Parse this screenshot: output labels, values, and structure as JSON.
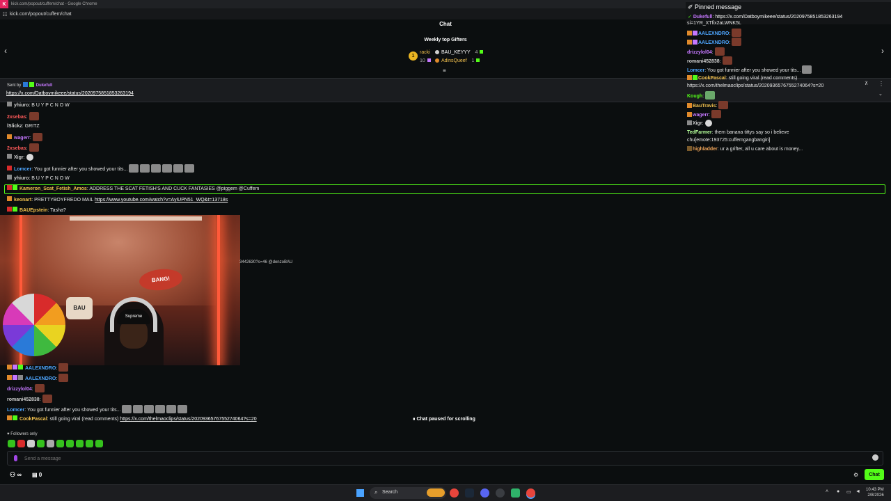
{
  "browser": {
    "window_title": "kick.com/popout/cuffem/chat - Google Chrome",
    "url": "kick.com/popout/cuffem/chat"
  },
  "chat": {
    "title": "Chat",
    "weekly_title": "Weekly top Gifters",
    "gifters": [
      {
        "name": "racki",
        "count": ""
      },
      {
        "name": "BAU_KEYYY",
        "count": "4"
      },
      {
        "name": "",
        "count": "10"
      },
      {
        "name": "AdinsQueef",
        "count": "1"
      }
    ],
    "rank": "1"
  },
  "pinned_left": {
    "sent_by": "Sent by",
    "user": "Dukefull",
    "link": "https://x.com/Datboymikeee/status/2020975851853263194"
  },
  "messages_left": [
    {
      "user": "yhiuro",
      "text": ": B U Y P C N O W",
      "color": "#cfcfcf"
    },
    {
      "user": "2xsebas",
      "text": ":",
      "color": "#ff5a5a"
    },
    {
      "user": "lSlickz",
      "text": ": GRITZ",
      "color": "#cfcfcf"
    },
    {
      "user": "wagerr",
      "text": ":",
      "color": "#c678ff"
    },
    {
      "user": "2xsebas",
      "text": ":",
      "color": "#ff5a5a"
    },
    {
      "user": "Xigr",
      "text": ":",
      "color": "#cfcfcf"
    },
    {
      "user": "Lomcer",
      "text": ": You got funnier after you showed your tits...",
      "color": "#4ea6ff"
    },
    {
      "user": "yhiuro",
      "text": ": B U Y P C N O W",
      "color": "#cfcfcf"
    },
    {
      "user": "Kameron_Scat_Fetish_Amos",
      "text": ": ADDRESS THE SCAT FETISH'S AND CUCK FANTASIES @piggem @Cuffem",
      "color": "#f2c14e"
    },
    {
      "user": "keonart",
      "text": ": PRETTYBOYFREDO MAIL",
      "link": "https://www.youtube.com/watch?v=AyiUPN51_WQ&t=13718s",
      "color": "#f2c14e"
    },
    {
      "user": "BAUEpstein",
      "text": ": Tasha?",
      "color": "#f2c14e"
    },
    {
      "user": "AALEXNDRO",
      "text": ":",
      "color": "#4ea6ff"
    },
    {
      "user": "AALEXNDRO",
      "text": ":",
      "color": "#4ea6ff"
    },
    {
      "user": "drizzylol04",
      "text": ":",
      "color": "#c678ff"
    },
    {
      "user": "romani452838",
      "text": ":",
      "color": "#cfcfcf"
    },
    {
      "user": "Lomcer",
      "text": ": You got funnier after you showed your tits...",
      "color": "#4ea6ff"
    },
    {
      "user": "CookPascal",
      "text": ": still going viral (read comments)",
      "link": "https://x.com/thelmaoclips/status/2020936576755274064?s=20",
      "color": "#f2c14e"
    }
  ],
  "webcam": {
    "sign": "BANG!",
    "pillow": "BAU",
    "cap": "Supreme",
    "peek_text": "3442630?s=46 @denzoBAU"
  },
  "pinned_right": {
    "header": "Pinned message",
    "user": "Dukefull",
    "link": "https://x.com/Datboymikeee/status/2020975851853263194"
  },
  "messages_right": [
    {
      "user": "",
      "text": "si=1YR_XTfix2aLWNK5L",
      "color": "#cfcfcf"
    },
    {
      "user": "AALEXNDRO",
      "text": ":",
      "color": "#4ea6ff"
    },
    {
      "user": "AALEXNDRO",
      "text": ":",
      "color": "#4ea6ff"
    },
    {
      "user": "drizzylol04",
      "text": ":",
      "color": "#c678ff"
    },
    {
      "user": "romani452838",
      "text": ":",
      "color": "#cfcfcf"
    },
    {
      "user": "Lomcer",
      "text": ": You got funnier after you showed your tits...",
      "color": "#4ea6ff"
    },
    {
      "user": "CookPascal",
      "text": ": still going viral (read comments)",
      "color": "#f2c14e"
    },
    {
      "user": "",
      "text": "https://x.com/thelmaoclips/status/2020936576755274064?s=20",
      "color": "#cfcfcf"
    },
    {
      "user": "Kough",
      "text": ":",
      "color": "#53fc18"
    },
    {
      "user": "BauTravis",
      "text": ":",
      "color": "#f2c14e"
    },
    {
      "user": "wagerr",
      "text": ":",
      "color": "#c678ff"
    },
    {
      "user": "Xigr",
      "text": ":",
      "color": "#cfcfcf"
    },
    {
      "user": "TedFarmer",
      "text": ": them banana tittys say so i believe",
      "color": "#b6ff9a"
    },
    {
      "user": "",
      "text": "chu[emote:193725:cuffemgangbangin]",
      "color": "#cfcfcf"
    },
    {
      "user": "highladder",
      "text": ": ur a grifter, all u care about is money...",
      "color": "#f2a65a"
    }
  ],
  "footer": {
    "paused": "Chat paused for scrolling",
    "followers_only": "Followers only",
    "send_placeholder": "Send a message",
    "gift_count": "0",
    "infinity": "∞",
    "chat_button": "Chat"
  },
  "taskbar": {
    "search": "Search",
    "time": "10:43 PM",
    "date": "2/8/2026"
  }
}
